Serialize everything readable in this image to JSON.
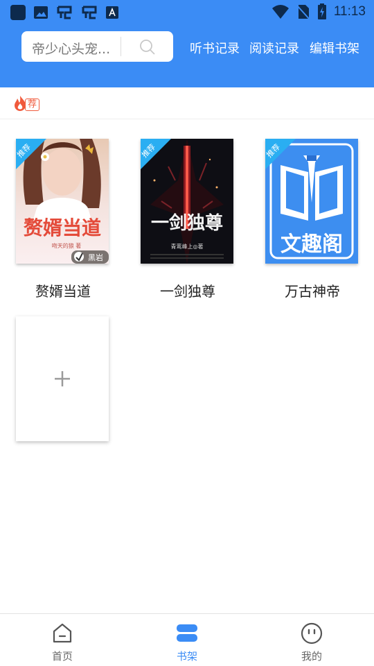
{
  "status_bar": {
    "time": "11:13",
    "icons": [
      "app-icon",
      "image-icon",
      "bug-icon",
      "bug-icon",
      "keyboard-icon",
      "wifi-icon",
      "no-sim-icon",
      "battery-charging-icon"
    ]
  },
  "header": {
    "search_placeholder": "帝少心头宠...",
    "links": [
      "听书记录",
      "阅读记录",
      "编辑书架"
    ],
    "background_color": "#3b8cf5"
  },
  "recommend": {
    "badge_label": "荐",
    "badge_color": "#f05a3c"
  },
  "books": [
    {
      "title": "赘婿当道",
      "corner_label": "推荐",
      "cover_text": "赘婿当道",
      "cover_author": "吻天的狼 著",
      "cover_publisher": "黑岩"
    },
    {
      "title": "一剑独尊",
      "corner_label": "推荐",
      "cover_text": "一剑独尊",
      "cover_author": "青鸾峰上◎著"
    },
    {
      "title": "万古神帝",
      "corner_label": "推荐",
      "cover_text": "文趣阁"
    }
  ],
  "add_book": {
    "icon": "plus-icon"
  },
  "bottom_nav": {
    "items": [
      {
        "label": "首页",
        "icon": "home-icon",
        "active": false
      },
      {
        "label": "书架",
        "icon": "bookshelf-icon",
        "active": true
      },
      {
        "label": "我的",
        "icon": "profile-face-icon",
        "active": false
      }
    ],
    "active_color": "#3b8cf5"
  }
}
